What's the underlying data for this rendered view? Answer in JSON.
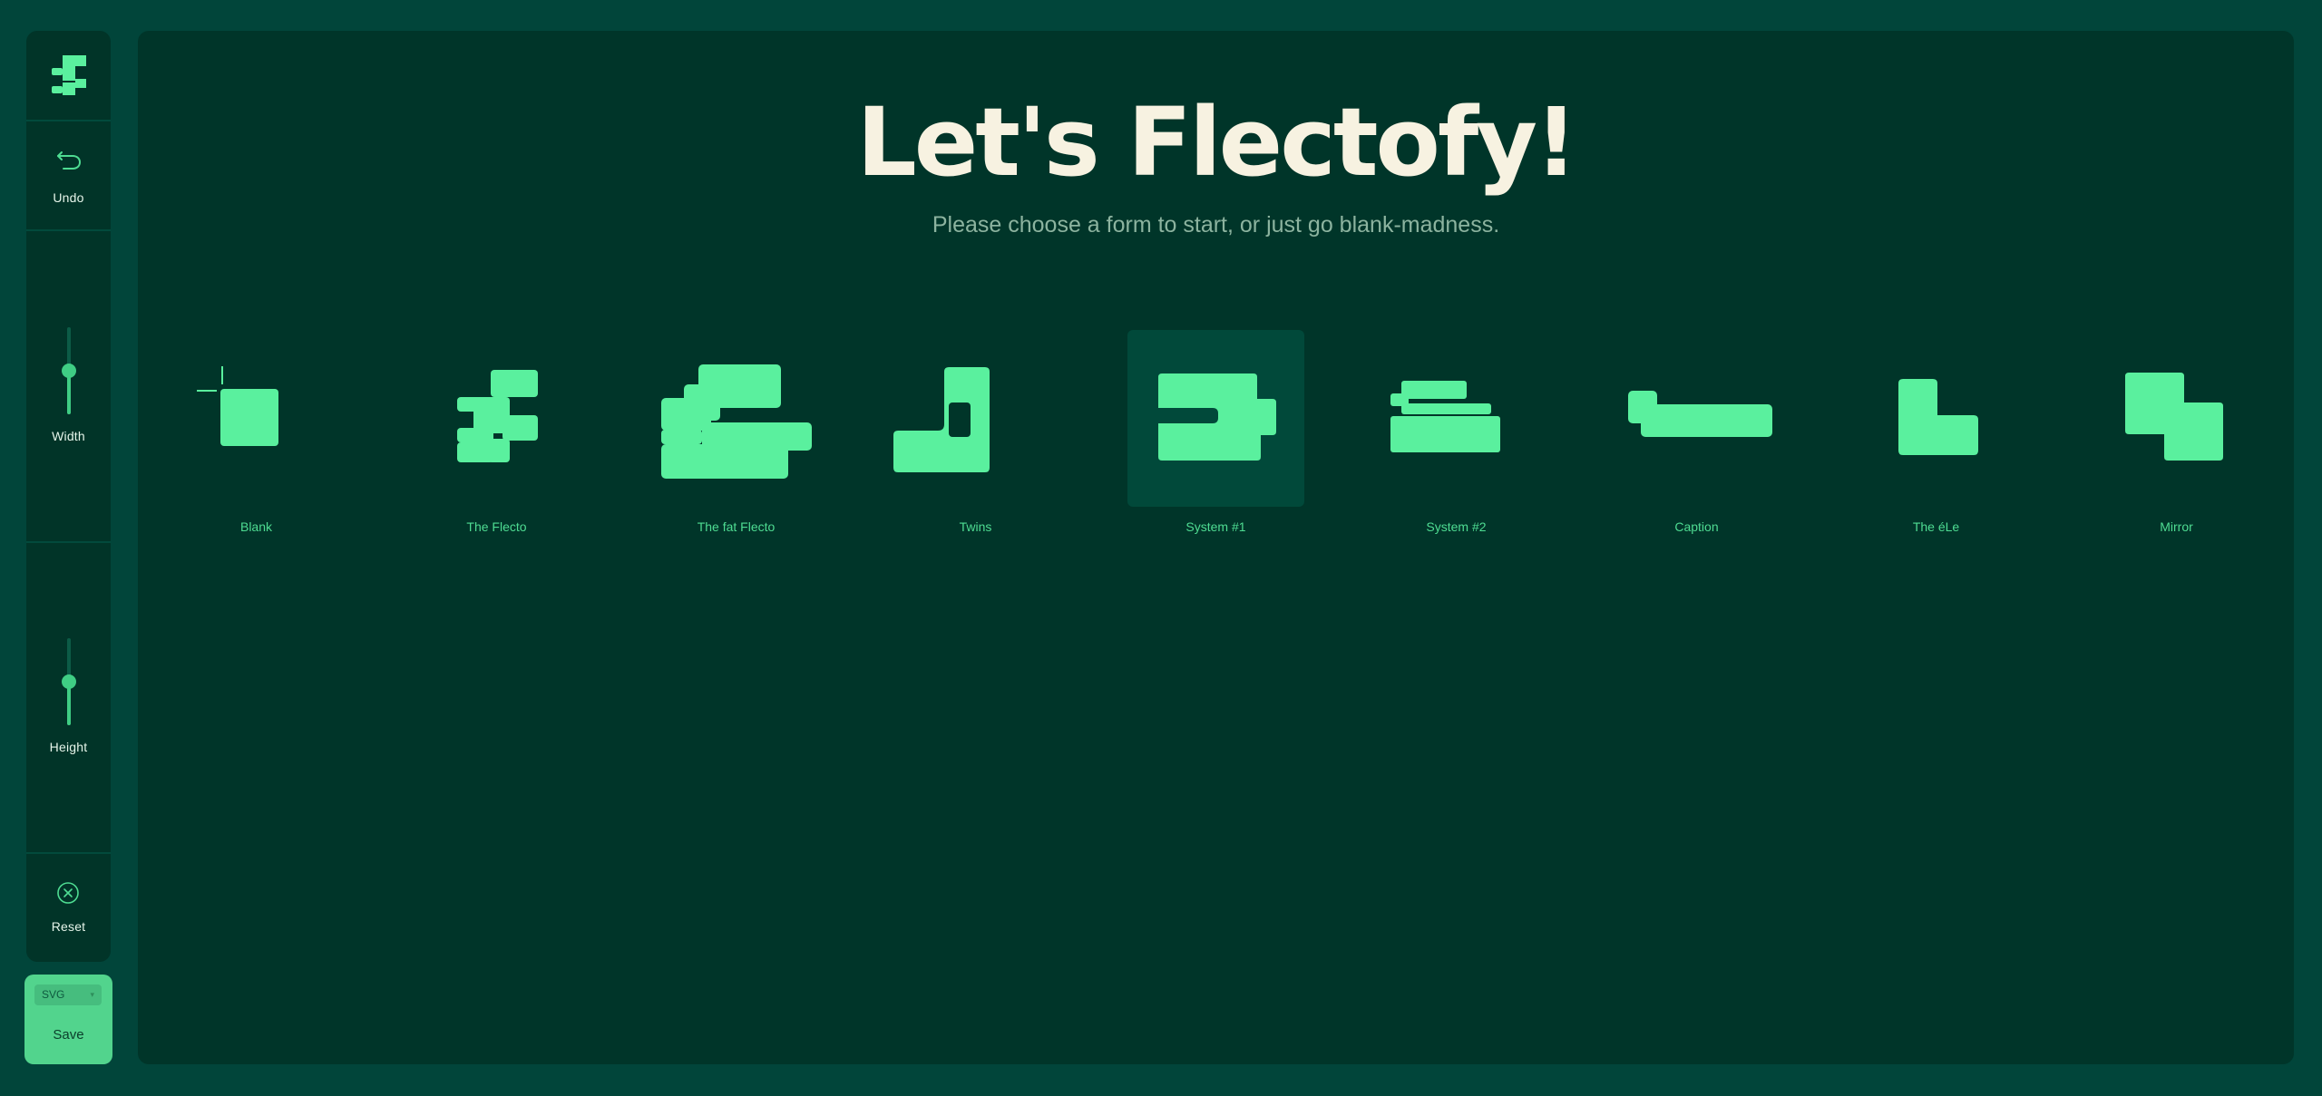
{
  "app": {
    "title": "Let's Flectofy!",
    "subtitle": "Please choose a form to start, or just go blank-madness."
  },
  "sidebar": {
    "undo_label": "Undo",
    "width_label": "Width",
    "width_level": 0.5,
    "height_label": "Height",
    "height_level": 0.5,
    "reset_label": "Reset",
    "format": "SVG",
    "save_label": "Save"
  },
  "forms": [
    {
      "label": "Blank",
      "selected": false
    },
    {
      "label": "The Flecto",
      "selected": false
    },
    {
      "label": "The fat Flecto",
      "selected": false
    },
    {
      "label": "Twins",
      "selected": false
    },
    {
      "label": "System #1",
      "selected": true
    },
    {
      "label": "System #2",
      "selected": false
    },
    {
      "label": "Caption",
      "selected": false
    },
    {
      "label": "The éLe",
      "selected": false
    },
    {
      "label": "Mirror",
      "selected": false
    }
  ],
  "colors": {
    "background": "#01453A",
    "panel": "#003529",
    "accent": "#5AF09E",
    "title": "#F7F2E1"
  }
}
